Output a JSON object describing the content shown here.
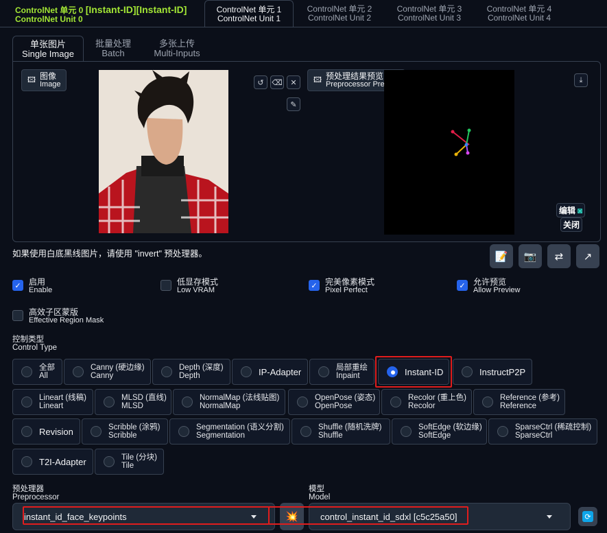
{
  "unit_tabs": {
    "unit0": {
      "zh": "ControlNet 单元 0",
      "tag": "[Instant-ID][Instant-ID]",
      "en": "ControlNet Unit 0"
    },
    "tabs": [
      {
        "zh": "ControlNet 单元 1",
        "en": "ControlNet Unit 1"
      },
      {
        "zh": "ControlNet 单元 2",
        "en": "ControlNet Unit 2"
      },
      {
        "zh": "ControlNet 单元 3",
        "en": "ControlNet Unit 3"
      },
      {
        "zh": "ControlNet 单元 4",
        "en": "ControlNet Unit 4"
      }
    ]
  },
  "sub_tabs": [
    {
      "zh": "单张图片",
      "en": "Single Image"
    },
    {
      "zh": "批量处理",
      "en": "Batch"
    },
    {
      "zh": "多张上传",
      "en": "Multi-Inputs"
    }
  ],
  "image_label": {
    "zh": "图像",
    "en": "Image"
  },
  "preview_label": {
    "zh": "预处理结果预览",
    "en": "Preprocessor Preview"
  },
  "edit_label": "编辑",
  "close_label": "关闭",
  "hint": "如果使用白底黑线图片，请使用 \"invert\" 预处理器。",
  "checkboxes": [
    {
      "zh": "启用",
      "en": "Enable",
      "checked": true
    },
    {
      "zh": "低显存模式",
      "en": "Low VRAM",
      "checked": false
    },
    {
      "zh": "完美像素模式",
      "en": "Pixel Perfect",
      "checked": true
    },
    {
      "zh": "允许预览",
      "en": "Allow Preview",
      "checked": true
    },
    {
      "zh": "高效子区蒙版",
      "en": "Effective Region Mask",
      "checked": false
    }
  ],
  "control_type_label": {
    "zh": "控制类型",
    "en": "Control Type"
  },
  "control_types": [
    {
      "zh": "全部",
      "en": "All"
    },
    {
      "zh": "Canny (硬边缘)",
      "en": "Canny"
    },
    {
      "zh": "Depth (深度)",
      "en": "Depth"
    },
    {
      "single": "IP-Adapter"
    },
    {
      "zh": "局部重绘",
      "en": "Inpaint"
    },
    {
      "single": "Instant-ID",
      "selected": true
    },
    {
      "single": "InstructP2P"
    },
    {
      "zh": "Lineart (线稿)",
      "en": "Lineart"
    },
    {
      "zh": "MLSD (直线)",
      "en": "MLSD"
    },
    {
      "zh": "NormalMap (法线贴图)",
      "en": "NormalMap"
    },
    {
      "zh": "OpenPose (姿态)",
      "en": "OpenPose"
    },
    {
      "zh": "Recolor (重上色)",
      "en": "Recolor"
    },
    {
      "zh": "Reference (参考)",
      "en": "Reference"
    },
    {
      "single": "Revision"
    },
    {
      "zh": "Scribble (涂鸦)",
      "en": "Scribble"
    },
    {
      "zh": "Segmentation (语义分割)",
      "en": "Segmentation"
    },
    {
      "zh": "Shuffle (随机洗牌)",
      "en": "Shuffle"
    },
    {
      "zh": "SoftEdge (软边缘)",
      "en": "SoftEdge"
    },
    {
      "zh": "SparseCtrl (稀疏控制)",
      "en": "SparseCtrl"
    },
    {
      "single": "T2I-Adapter"
    },
    {
      "zh": "Tile (分块)",
      "en": "Tile"
    }
  ],
  "preprocessor": {
    "zh": "预处理器",
    "en": "Preprocessor",
    "value": "instant_id_face_keypoints"
  },
  "model": {
    "zh": "模型",
    "en": "Model",
    "value": "control_instant_id_sdxl [c5c25a50]"
  },
  "colors": {
    "accent": "#2563eb",
    "unit0": "#a3e635",
    "highlight": "#e11d1d"
  }
}
